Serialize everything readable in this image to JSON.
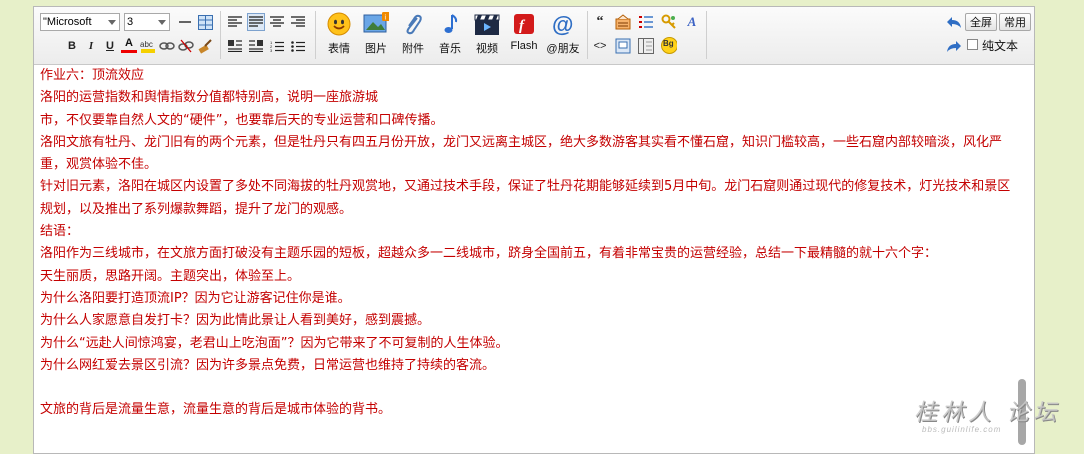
{
  "toolbar": {
    "font_family": "\"Microsoft",
    "font_size": "3",
    "buttons": {
      "emoji": "表情",
      "image": "图片",
      "attachment": "附件",
      "music": "音乐",
      "video": "视频",
      "flash": "Flash",
      "mention": "@朋友"
    },
    "fullscreen": "全屏",
    "common": "常用",
    "plain_text": "纯文本",
    "bold": "B",
    "italic": "I",
    "underline": "U",
    "font_color": "A",
    "bg_label": "Bg",
    "quote": "“",
    "code": "<>"
  },
  "content": {
    "paragraphs": [
      "作业六：顶流效应",
      "洛阳的运营指数和舆情指数分值都特别高，说明一座旅游城",
      "市，不仅要靠自然人文的“硬件”，也要靠后天的专业运营和口碑传播。",
      "洛阳文旅有牡丹、龙门旧有的两个元素，但是牡丹只有四五月份开放，龙门又远离主城区，绝大多数游客其实看不懂石窟，知识门槛较高，一些石窟内部较暗淡，风化严重，观赏体验不佳。",
      "针对旧元素，洛阳在城区内设置了多处不同海拔的牡丹观赏地，又通过技术手段，保证了牡丹花期能够延续到5月中旬。龙门石窟则通过现代的修复技术，灯光技术和景区规划，以及推出了系列爆款舞蹈，提升了龙门的观感。",
      "结语：",
      "洛阳作为三线城市，在文旅方面打破没有主题乐园的短板，超越众多一二线城市，跻身全国前五，有着非常宝贵的运营经验，总结一下最精髓的就十六个字：",
      "天生丽质，思路开阔。主题突出，体验至上。",
      "为什么洛阳要打造顶流IP？因为它让游客记住你是谁。",
      "为什么人家愿意自发打卡？因为此情此景让人看到美好，感到震撼。",
      "为什么“远赴人间惊鸿宴，老君山上吃泡面”？因为它带来了不可复制的人生体验。",
      "为什么网红爱去景区引流？因为许多景点免费，日常运营也维持了持续的客流。",
      "",
      "文旅的背后是流量生意，流量生意的背后是城市体验的背书。"
    ]
  },
  "watermark": {
    "line1": "桂林人 论坛",
    "line2": "bbs.guilinlife.com"
  },
  "colors": {
    "page_bg": "#e7f0c9",
    "text_red": "#c40000",
    "toolbar_bg": "#f2f2f2"
  }
}
